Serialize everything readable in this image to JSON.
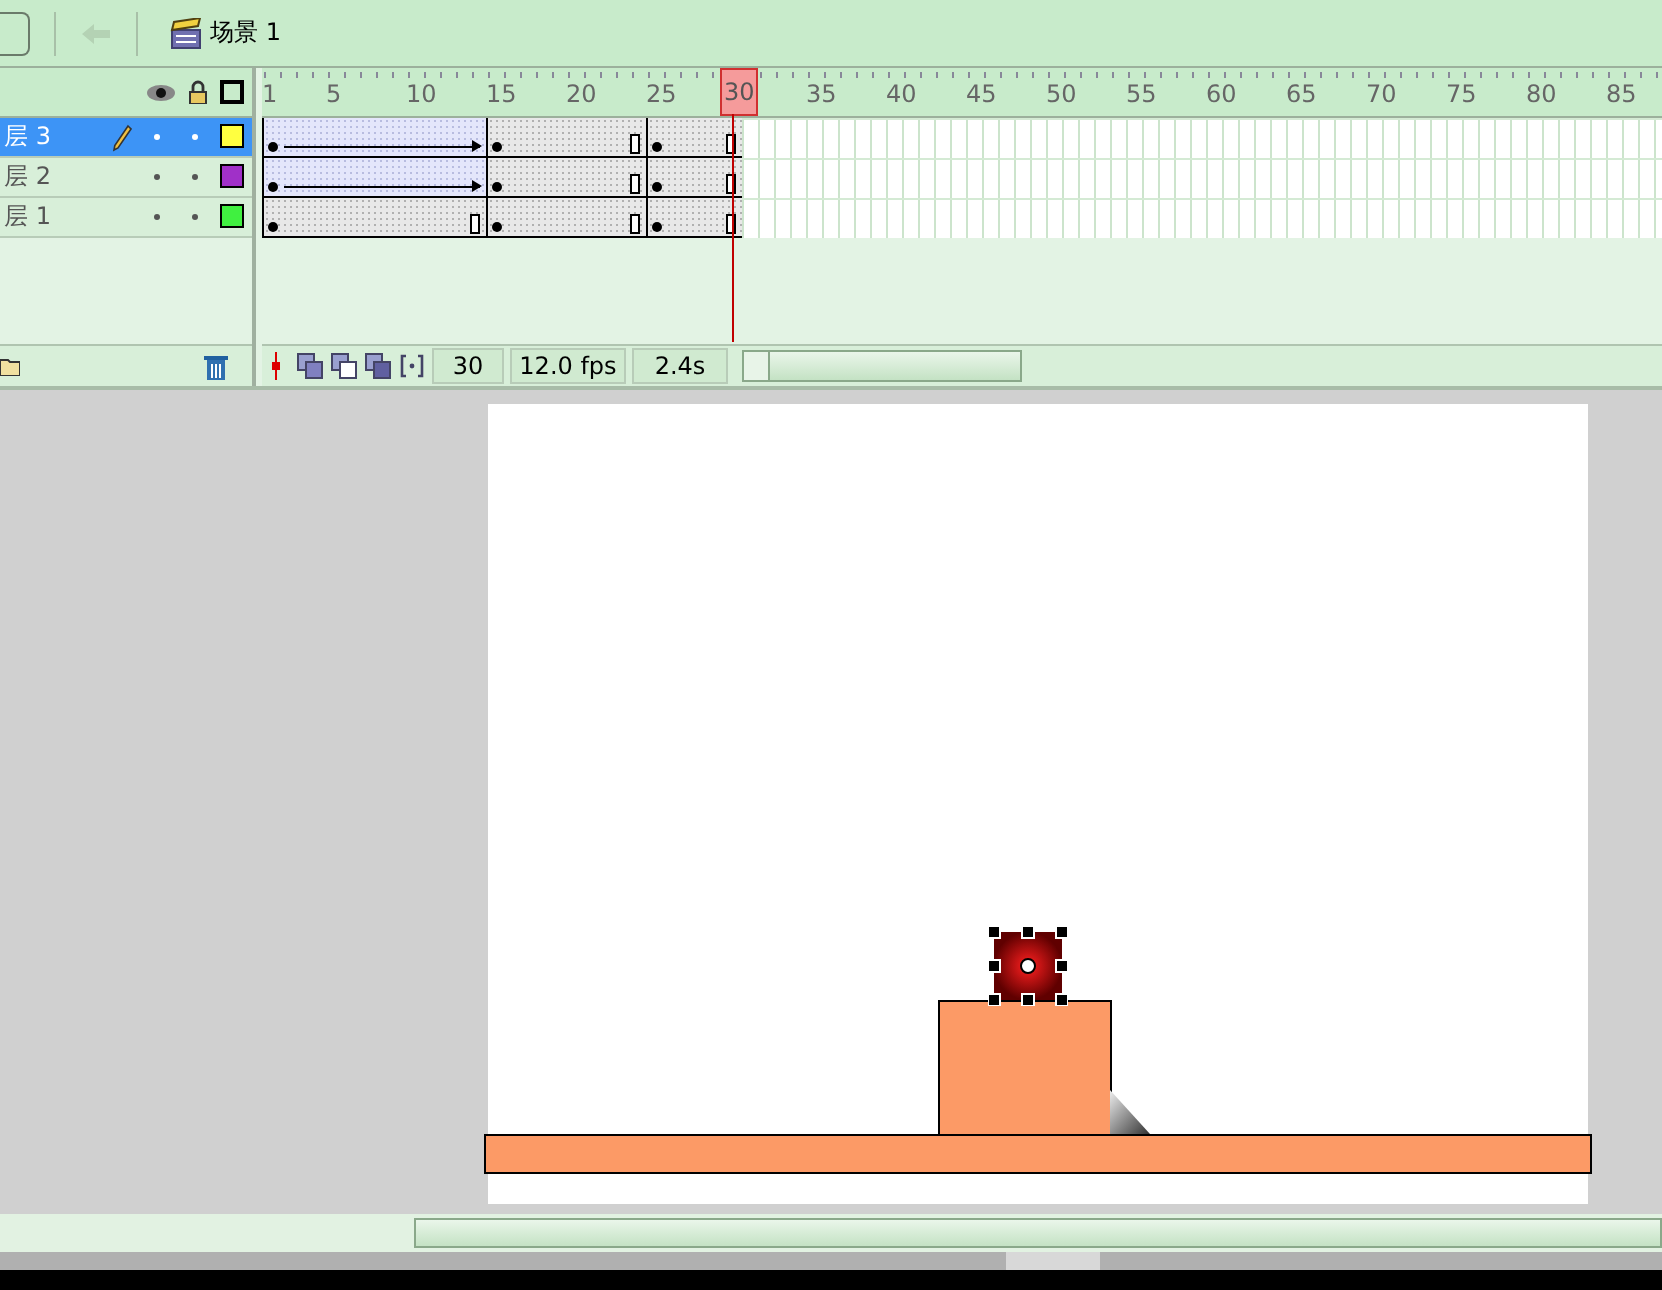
{
  "toolbar": {
    "scene": "场景 1"
  },
  "ruler": {
    "ticks": [
      {
        "label": "1",
        "selected": false
      },
      {
        "label": "5",
        "selected": false
      },
      {
        "label": "10",
        "selected": false
      },
      {
        "label": "15",
        "selected": false
      },
      {
        "label": "20",
        "selected": false
      },
      {
        "label": "25",
        "selected": false
      },
      {
        "label": "30",
        "selected": true
      },
      {
        "label": "35",
        "selected": false
      },
      {
        "label": "40",
        "selected": false
      },
      {
        "label": "45",
        "selected": false
      },
      {
        "label": "50",
        "selected": false
      },
      {
        "label": "55",
        "selected": false
      },
      {
        "label": "60",
        "selected": false
      },
      {
        "label": "65",
        "selected": false
      },
      {
        "label": "70",
        "selected": false
      },
      {
        "label": "75",
        "selected": false
      },
      {
        "label": "80",
        "selected": false
      },
      {
        "label": "85",
        "selected": false
      }
    ]
  },
  "layers": [
    {
      "name": "层 3",
      "selected": true,
      "color": "#ffff40",
      "spans": [
        {
          "kind": "tween"
        },
        {
          "kind": "still"
        },
        {
          "kind": "still"
        }
      ]
    },
    {
      "name": "层 2",
      "selected": false,
      "color": "#a030c8",
      "spans": [
        {
          "kind": "tween"
        },
        {
          "kind": "still"
        },
        {
          "kind": "still"
        }
      ]
    },
    {
      "name": "层 1",
      "selected": false,
      "color": "#40f040",
      "spans": [
        {
          "kind": "still"
        },
        {
          "kind": "still"
        },
        {
          "kind": "still"
        }
      ]
    }
  ],
  "status": {
    "frame": "30",
    "fps": "12.0 fps",
    "time": "2.4s"
  }
}
